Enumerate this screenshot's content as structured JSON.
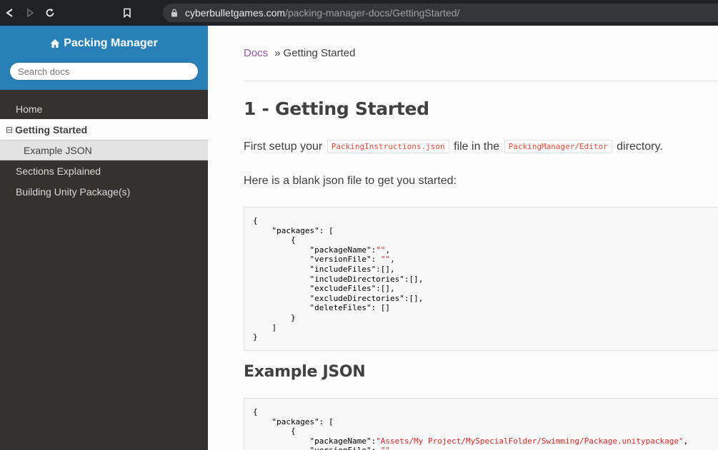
{
  "browser": {
    "url_domain": "cyberbulletgames.com",
    "url_path": "/packing-manager-docs/GettingStarted/"
  },
  "sidebar": {
    "project_name": "Packing Manager",
    "search_placeholder": "Search docs",
    "items": [
      {
        "label": "Home"
      },
      {
        "label": "Getting Started",
        "toggle": "⊟"
      },
      {
        "label": "Example JSON"
      },
      {
        "label": "Sections Explained"
      },
      {
        "label": "Building Unity Package(s)"
      }
    ]
  },
  "content": {
    "breadcrumb": {
      "docs": "Docs",
      "separator": "»",
      "current": "Getting Started"
    },
    "heading1": "1 - Getting Started",
    "para1": {
      "prefix": "First setup your",
      "code1": "PackingInstructions.json",
      "middle": "file in the",
      "code2": "PackingManager/Editor",
      "suffix": "directory."
    },
    "para2": "Here is a blank json file to get you started:",
    "code_block1": {
      "lines": [
        "{",
        "    \"packages\": [",
        "        {",
        "            \"packageName\":\"\",",
        "            \"versionFile\": \"\",",
        "            \"includeFiles\":[],",
        "            \"includeDirectories\":[],",
        "            \"excludeFiles\":[],",
        "            \"excludeDirectories\":[],",
        "            \"deleteFiles\": []",
        "        }",
        "    ]",
        "}"
      ]
    },
    "heading2": "Example JSON",
    "code_block2": {
      "lines": [
        "{",
        "    \"packages\": [",
        "        {",
        "            \"packageName\":\"Assets/My Project/MySpecialFolder/Swimming/Package.unitypackage\",",
        "            \"versionFile\": \"\""
      ]
    }
  },
  "colors": {
    "sidebar_top": "#2980b9",
    "sidebar_bg": "#343131",
    "link": "#9b59b6",
    "code_literal": "#e74c3c"
  }
}
